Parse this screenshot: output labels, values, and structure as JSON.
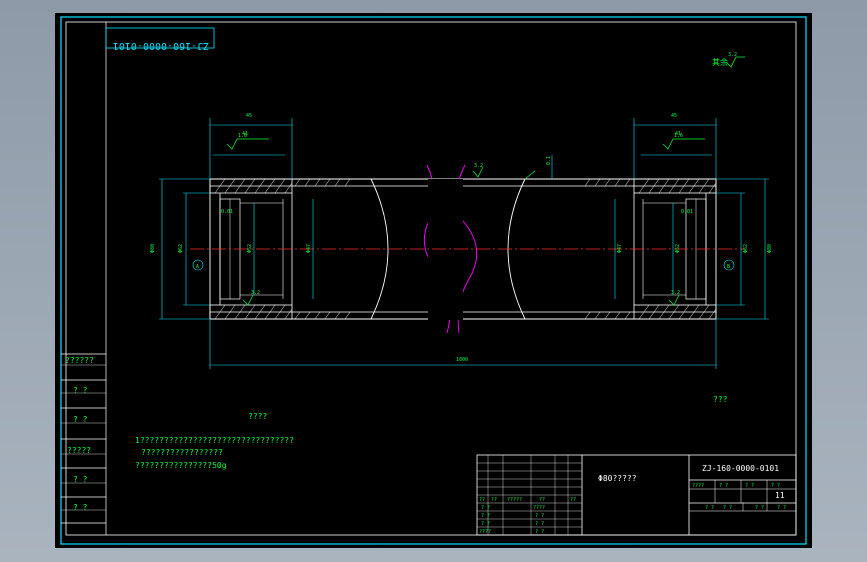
{
  "drawing": {
    "code_mirrored": "ZJ-160-0000-0101",
    "roughness_top": "3.2",
    "roughness_mid": "3.2",
    "roughness_label": "其余",
    "dims": {
      "top_left_a": "45",
      "top_right_a": "45",
      "top_left_b": "41",
      "top_right_b": "41",
      "overall_length": "1000",
      "left_outer": "Φ80",
      "right_outer": "Φ80",
      "left_bore": "Φ62",
      "right_bore": "Φ62",
      "left_inner": "Φ52",
      "right_inner": "Φ52",
      "left_seat": "Φ47",
      "right_seat": "Φ47",
      "center_a": "A",
      "center_b": "B",
      "gap": "0.1",
      "rough_seat_l": "1.6",
      "rough_seat_r": "1.6",
      "rough_inner_l": "3.2",
      "rough_inner_r": "3.2",
      "tol_l": "0.01",
      "tol_r": "0.01"
    }
  },
  "notes": {
    "title": "????",
    "line1": "1????????????????????????????????",
    "line2": "?????????????????",
    "line3": "????????????????50g",
    "mark_right": "???"
  },
  "left_strip": {
    "cells": [
      "??????",
      "? ?",
      "? ?",
      "?????",
      "? ?",
      "? ?"
    ]
  },
  "title_block": {
    "material": "Φ80?????",
    "drawing_no": "ZJ-160-0000-0101",
    "hdr_cells": [
      "????",
      "? ?",
      "? ?",
      "? ?"
    ],
    "qty": "11",
    "bottom_cells": [
      "? ?",
      "? ?",
      "? ?",
      "? ?"
    ],
    "rev_header": [
      "??",
      "??",
      "?????",
      "??",
      "??"
    ],
    "rev_rows": [
      [
        "? ?",
        "????"
      ],
      [
        "? ?",
        "? ?"
      ],
      [
        "? ?",
        "? ?"
      ],
      [
        "????",
        "? ?"
      ]
    ]
  }
}
